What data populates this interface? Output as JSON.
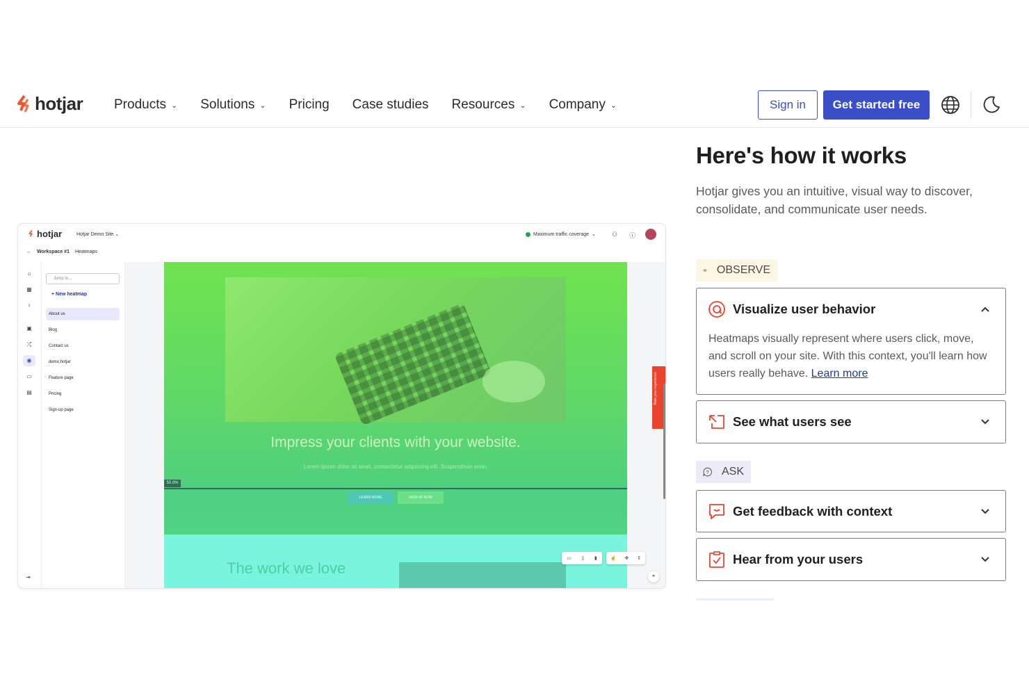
{
  "nav": {
    "logo_text": "hotjar",
    "items": [
      {
        "label": "Products",
        "has_menu": true
      },
      {
        "label": "Solutions",
        "has_menu": true
      },
      {
        "label": "Pricing",
        "has_menu": false
      },
      {
        "label": "Case studies",
        "has_menu": false
      },
      {
        "label": "Resources",
        "has_menu": true
      },
      {
        "label": "Company",
        "has_menu": true
      }
    ],
    "chevron": "⌄",
    "sign_in": "Sign in",
    "get_started": "Get started free",
    "globe_icon": "globe-icon",
    "theme_icon": "moon-icon"
  },
  "app": {
    "logo_text": "hotjar",
    "site": "Hotjar Demo Site",
    "coverage": "Maximum traffic coverage",
    "crumbs": {
      "workspace": "Workspace #1",
      "section": "Heatmaps"
    },
    "search_placeholder": "Jump to...",
    "new_heatmap": "New heatmap",
    "pages": [
      "About us",
      "Blog",
      "Contact us",
      "demo.hotjar",
      "Feature page",
      "Pricing",
      "Sign-up page"
    ],
    "heat_title": "Impress your clients with your website.",
    "heat_sub": "Lorem ipsum dolor sit amet, consectetur adipiscing elit. Suspendisse enim.",
    "fold_label": "50.0%",
    "btn_learn": "LEARN MORE",
    "btn_signup": "SIGN UP NOW",
    "heat_love": "The work we love",
    "rate_tab": "Rate your experience"
  },
  "section": {
    "heading": "Here's how it works",
    "lead": "Hotjar gives you an intuitive, visual way to discover, consolidate, and communicate user needs.",
    "observe_label": "OBSERVE",
    "ask_label": "ASK",
    "accordion": [
      {
        "title": "Visualize user behavior",
        "expanded": true,
        "body": "Heatmaps visually represent where users click, move, and scroll on your site. With this context, you'll learn how users really behave.",
        "link": "Learn more",
        "icon": "heatmap-icon"
      },
      {
        "title": "See what users see",
        "expanded": false,
        "icon": "recording-icon"
      },
      {
        "title": "Get feedback with context",
        "expanded": false,
        "icon": "feedback-icon"
      },
      {
        "title": "Hear from your users",
        "expanded": false,
        "icon": "survey-icon"
      }
    ]
  },
  "colors": {
    "brand_blue": "#3a4fc7",
    "accent_orange": "#e8442e",
    "observe_bg": "#fdf6e2",
    "ask_bg": "#ecebf8"
  }
}
